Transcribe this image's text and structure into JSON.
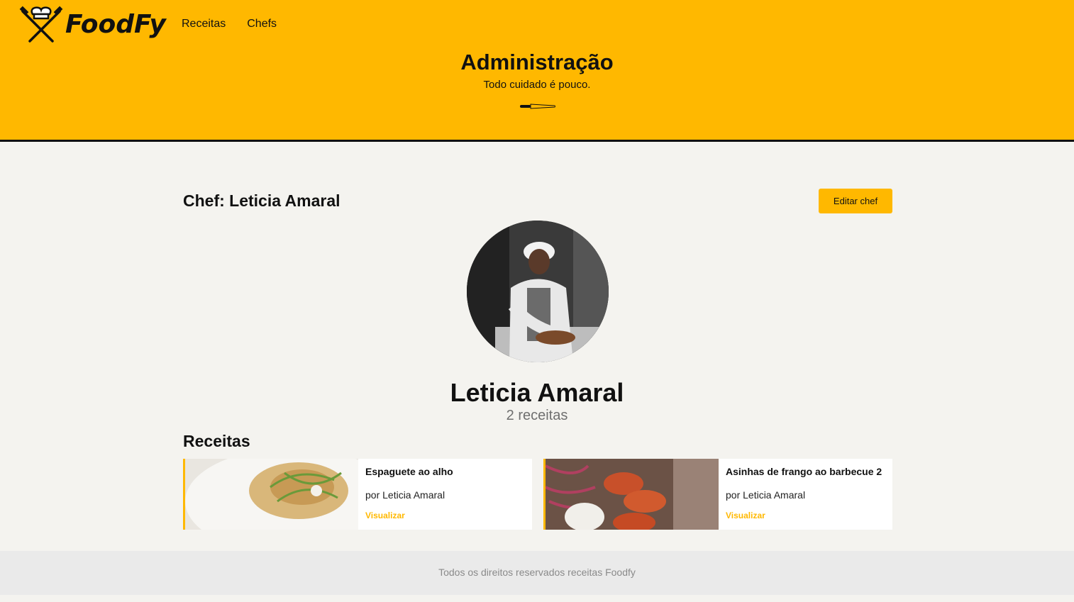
{
  "header": {
    "brand": "FoodFy",
    "nav": [
      "Receitas",
      "Chefs"
    ],
    "title": "Administração",
    "subtitle": "Todo cuidado é pouco."
  },
  "chef": {
    "heading": "Chef: Leticia Amaral",
    "edit_label": "Editar chef",
    "name": "Leticia Amaral",
    "count": "2 receitas"
  },
  "recipes": {
    "title": "Receitas",
    "items": [
      {
        "title": "Espaguete ao alho",
        "author": "por Leticia Amaral",
        "action": "Visualizar"
      },
      {
        "title": "Asinhas de frango ao barbecue 2",
        "author": "por Leticia Amaral",
        "action": "Visualizar"
      }
    ]
  },
  "footer": {
    "text": "Todos os direitos reservados receitas Foodfy"
  },
  "colors": {
    "accent": "#ffb800",
    "background": "#f4f3ef",
    "footer": "#eaeaea"
  }
}
